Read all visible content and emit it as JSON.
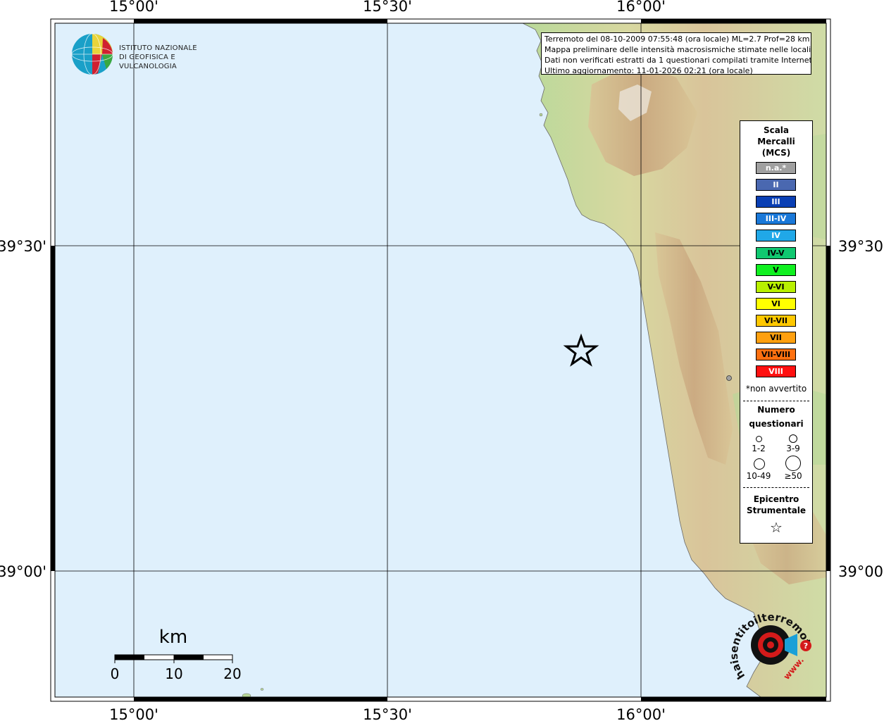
{
  "map": {
    "lon_labels": [
      "15°00'",
      "15°30'",
      "16°00'"
    ],
    "lat_labels": [
      "39°30'",
      "39°00'"
    ],
    "ocean_color": "#dff0fc",
    "grid_color": "#000000"
  },
  "info_box": {
    "line1": "Terremoto del 08-10-2009 07:55:48 (ora locale) ML=2.7 Prof=28 km",
    "line2": "Mappa preliminare delle intensità macrosismiche stimate nelle località",
    "line3": "Dati non verificati estratti da 1 questionari compilati tramite Internet.",
    "line4": "Ultimo aggiornamento: 11-01-2026 02:21 (ora locale)"
  },
  "logo": {
    "line1": "ISTITUTO NAZIONALE",
    "line2": "DI GEOFISICA E VULCANOLOGIA"
  },
  "legend": {
    "title1": "Scala",
    "title2": "Mercalli",
    "title3": "(MCS)",
    "scale": [
      {
        "label": "n.a.*",
        "color": "#a0a0a0",
        "text_color": "#ffffff"
      },
      {
        "label": "II",
        "color": "#4a68b0",
        "text_color": "#ffffff"
      },
      {
        "label": "III",
        "color": "#0a3fb4",
        "text_color": "#ffffff"
      },
      {
        "label": "III-IV",
        "color": "#1a78d8",
        "text_color": "#ffffff"
      },
      {
        "label": "IV",
        "color": "#20a8e8",
        "text_color": "#ffffff"
      },
      {
        "label": "IV-V",
        "color": "#10c870",
        "text_color": "#000000"
      },
      {
        "label": "V",
        "color": "#10f020",
        "text_color": "#000000"
      },
      {
        "label": "V-VI",
        "color": "#b8f000",
        "text_color": "#000000"
      },
      {
        "label": "VI",
        "color": "#ffff00",
        "text_color": "#000000"
      },
      {
        "label": "VI-VII",
        "color": "#ffc800",
        "text_color": "#000000"
      },
      {
        "label": "VII",
        "color": "#ffa010",
        "text_color": "#000000"
      },
      {
        "label": "VII-VIII",
        "color": "#ff7010",
        "text_color": "#000000"
      },
      {
        "label": "VIII",
        "color": "#ff1010",
        "text_color": "#ffffff"
      }
    ],
    "footnote": "*non avvertito",
    "count_title1": "Numero",
    "count_title2": "questionari",
    "counts": [
      "1-2",
      "3-9",
      "10-49",
      "≥50"
    ],
    "epi_title1": "Epicentro",
    "epi_title2": "Strumentale",
    "epi_symbol": "☆"
  },
  "scalebar": {
    "unit": "km",
    "ticks": [
      "0",
      "10",
      "20"
    ]
  },
  "badge": {
    "text_ring": "haisentitoilterremoto.it",
    "url": "www."
  }
}
